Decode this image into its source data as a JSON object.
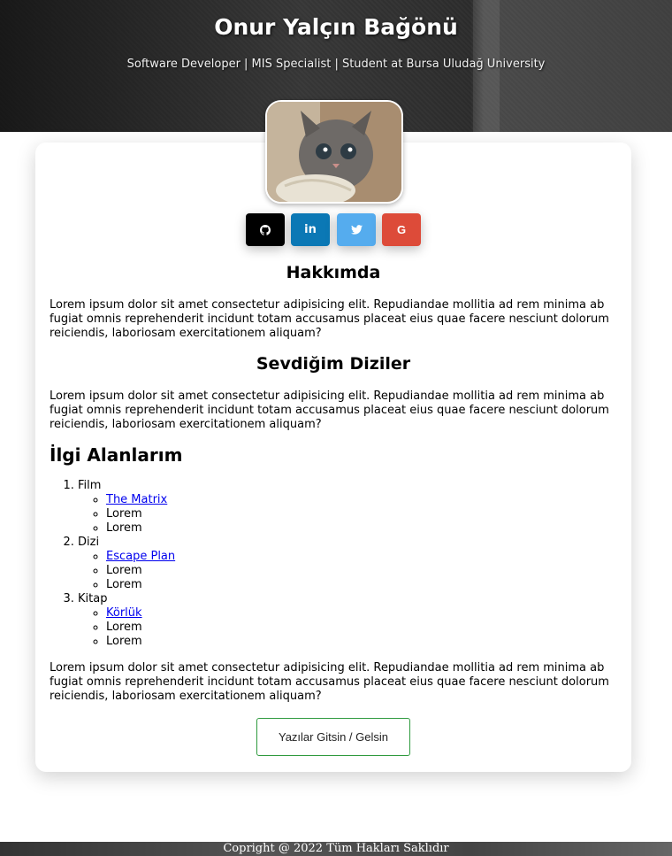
{
  "header": {
    "name": "Onur Yalçın Bağönü",
    "subtitle": "Software Developer | MIS Specialist | Student at Bursa Uludağ University"
  },
  "social": [
    {
      "name": "github",
      "icon": "github-icon",
      "color": "#000000"
    },
    {
      "name": "linkedin",
      "icon": "linkedin-icon",
      "label": "in",
      "color": "#0b78b5"
    },
    {
      "name": "twitter",
      "icon": "twitter-icon",
      "color": "#55acee"
    },
    {
      "name": "google",
      "icon": "google-icon",
      "label": "G",
      "color": "#dd4b39"
    }
  ],
  "about": {
    "title": "Hakkımda",
    "text": "Lorem ipsum dolor sit amet consectetur adipisicing elit. Repudiandae mollitia ad rem minima ab fugiat omnis reprehenderit incidunt totam accusamus placeat eius quae facere nesciunt dolorum reiciendis, laboriosam exercitationem aliquam?"
  },
  "series": {
    "title": "Sevdiğim Diziler",
    "text": "Lorem ipsum dolor sit amet consectetur adipisicing elit. Repudiandae mollitia ad rem minima ab fugiat omnis reprehenderit incidunt totam accusamus placeat eius quae facere nesciunt dolorum reiciendis, laboriosam exercitationem aliquam?"
  },
  "interests": {
    "title": "İlgi Alanlarım",
    "items": [
      {
        "label": "Film",
        "link": "The Matrix",
        "sub": [
          "Lorem",
          "Lorem"
        ]
      },
      {
        "label": "Dizi",
        "link": "Escape Plan",
        "sub": [
          "Lorem",
          "Lorem"
        ]
      },
      {
        "label": "Kitap",
        "link": "Körlük",
        "sub": [
          "Lorem",
          "Lorem"
        ]
      }
    ]
  },
  "closing_text": "Lorem ipsum dolor sit amet consectetur adipisicing elit. Repudiandae mollitia ad rem minima ab fugiat omnis reprehenderit incidunt totam accusamus placeat eius quae facere nesciunt dolorum reiciendis, laboriosam exercitationem aliquam?",
  "button_label": "Yazılar Gitsin / Gelsin",
  "footer": "Copright @ 2022 Tüm Hakları Saklıdır"
}
